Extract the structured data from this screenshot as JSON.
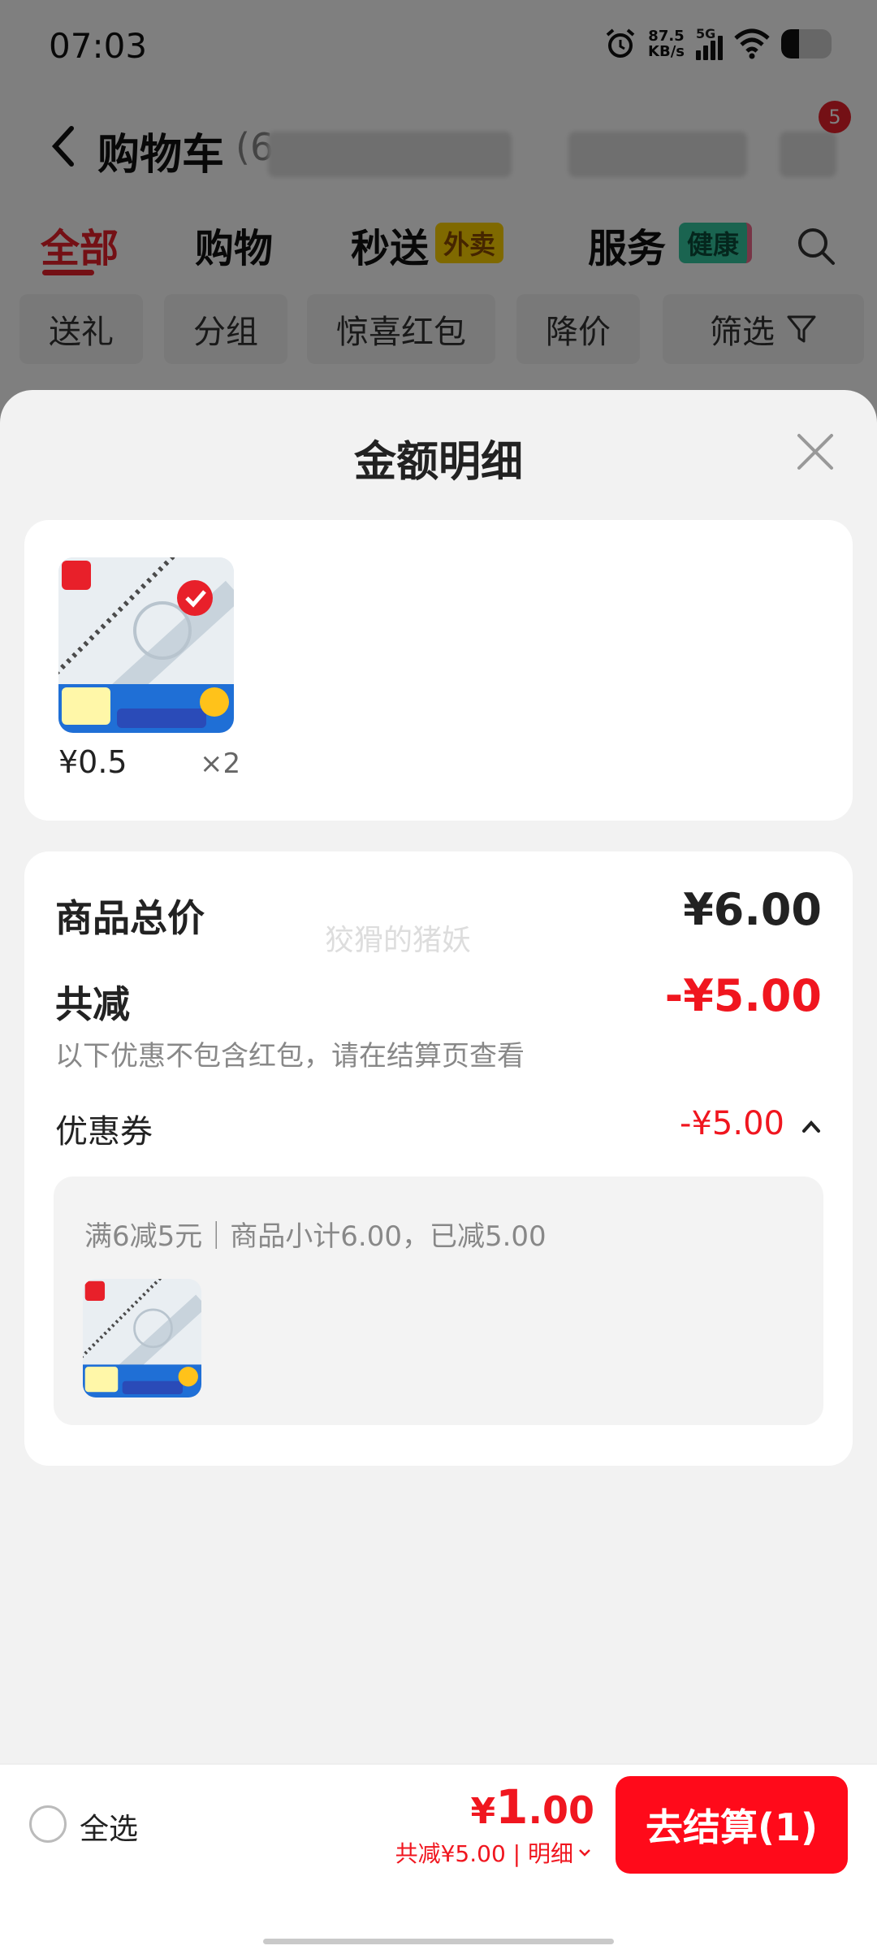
{
  "status_bar": {
    "time": "07:03",
    "net_speed_value": "87.5",
    "net_speed_unit": "KB/s",
    "network": "5G",
    "battery_level": 0.35
  },
  "cart_header": {
    "title": "购物车",
    "count_visible": "(6",
    "notification_count": "5"
  },
  "main_tabs": [
    {
      "label": "全部",
      "active": true
    },
    {
      "label": "购物"
    },
    {
      "label": "秒送",
      "tag": "外卖"
    },
    {
      "label": "服务",
      "tag": "健康"
    }
  ],
  "filters": [
    "送礼",
    "分组",
    "惊喜红包",
    "降价",
    "筛选"
  ],
  "sheet": {
    "title": "金额明细",
    "product": {
      "price": "¥0.5",
      "qty": "×2"
    },
    "summary": {
      "goods_total_label": "商品总价",
      "goods_total_value": "¥6.00",
      "watermark": "狡猾的猪妖",
      "discount_label": "共减",
      "discount_value": "-¥5.00",
      "discount_note": "以下优惠不包含红包，请在结算页查看",
      "coupon_label": "优惠券",
      "coupon_value": "-¥5.00",
      "coupon_detail": "满6减5元｜商品小计6.00，已减5.00"
    }
  },
  "bottom_bar": {
    "select_all": "全选",
    "total_yen": "¥",
    "total_int": "1",
    "total_cents": ".00",
    "total_detail": "共减¥5.00 | 明细",
    "checkout": "去结算(1)"
  },
  "colors": {
    "accent_red": "#f0161f",
    "checkout_red": "#ff0a1a",
    "tab_active": "#e8202a",
    "waimai_tag": "#ffd300",
    "health_tag": "#35c9a0"
  }
}
